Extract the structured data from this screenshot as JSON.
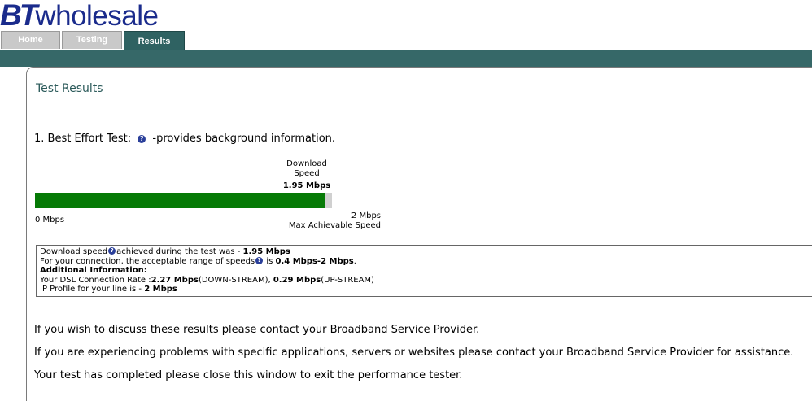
{
  "logo": {
    "bt": "BT",
    "text": "wholesale"
  },
  "tabs": {
    "home": "Home",
    "testing": "Testing",
    "results": "Results"
  },
  "page": {
    "title": "Test Results"
  },
  "best_effort": {
    "label": "1. Best Effort Test:",
    "info": "-provides background information."
  },
  "meter": {
    "label_line1": "Download",
    "label_line2": "Speed",
    "value": "1.95 Mbps",
    "min_label": "0 Mbps",
    "max_label": "2 Mbps",
    "max_caption": "Max Achievable Speed",
    "fill_fraction": 0.975,
    "fill_color": "#067a06"
  },
  "info_box": {
    "line1_pre": "Download speed",
    "line1_mid": "achieved during the test was - ",
    "line1_val": "1.95 Mbps",
    "line2_pre": "For your connection, the acceptable range of speeds",
    "line2_mid": " is ",
    "line2_val": "0.4 Mbps-2 Mbps",
    "line2_end": ".",
    "line3": "Additional Information:",
    "line4_pre": "Your DSL Connection Rate :",
    "line4_down": "2.27 Mbps",
    "line4_down_label": "(DOWN-STREAM), ",
    "line4_up": "0.29 Mbps",
    "line4_up_label": "(UP-STREAM)",
    "line5_pre": "IP Profile for your line is - ",
    "line5_val": "2 Mbps"
  },
  "messages": {
    "p1": "If you wish to discuss these results please contact your Broadband Service Provider.",
    "p2": "If you are experiencing problems with specific applications, servers or websites please contact your Broadband Service Provider for assistance.",
    "p3": "Your test has completed please close this window to exit the performance tester."
  },
  "colors": {
    "brand": "#1a2b8c",
    "band": "#366868",
    "title": "#2b5a5a"
  },
  "icons": {
    "help": "question-mark-icon"
  }
}
